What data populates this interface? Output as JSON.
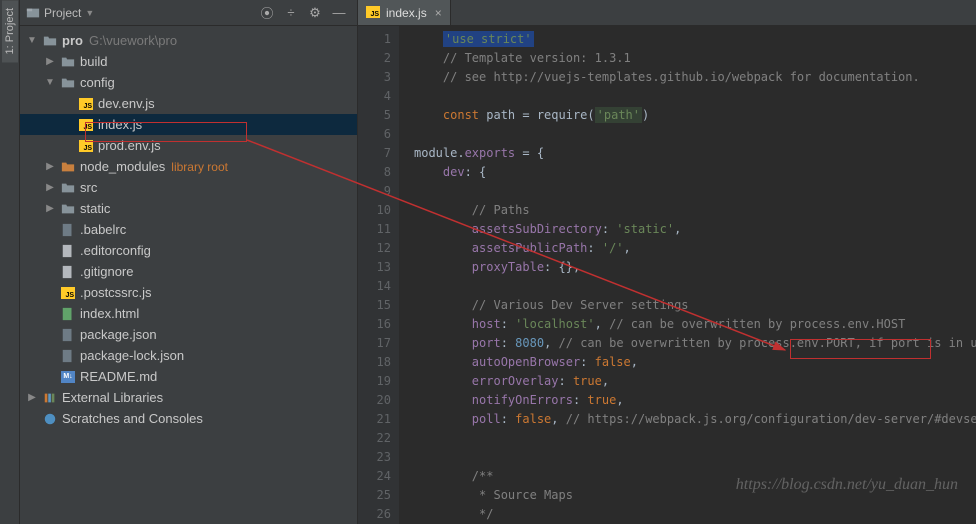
{
  "sidebar": {
    "tab_label": "1: Project"
  },
  "panel": {
    "title": "Project"
  },
  "project": {
    "root_name": "pro",
    "root_path": "G:\\vuework\\pro",
    "folders": {
      "build": "build",
      "config": "config",
      "dev_env": "dev.env.js",
      "index_js": "index.js",
      "prod_env": "prod.env.js",
      "node_modules": "node_modules",
      "library_root": "library root",
      "src": "src",
      "static": "static",
      "babelrc": ".babelrc",
      "editorconfig": ".editorconfig",
      "gitignore": ".gitignore",
      "postcssrc": ".postcssrc.js",
      "index_html": "index.html",
      "package_json": "package.json",
      "package_lock": "package-lock.json",
      "readme": "README.md"
    },
    "external_libs": "External Libraries",
    "scratches": "Scratches and Consoles"
  },
  "tabs": [
    {
      "label": "index.js"
    }
  ],
  "code": {
    "lines": [
      {
        "n": 1,
        "segs": [
          {
            "t": "    ",
            "c": ""
          },
          {
            "t": "'use strict'",
            "c": "tok-str hl-box"
          }
        ]
      },
      {
        "n": 2,
        "segs": [
          {
            "t": "    ",
            "c": ""
          },
          {
            "t": "//",
            "c": "tok-com"
          },
          {
            "t": " Template version: 1.3.1",
            "c": "tok-com"
          }
        ]
      },
      {
        "n": 3,
        "segs": [
          {
            "t": "    ",
            "c": ""
          },
          {
            "t": "// see http://vuejs-templates.github.io/webpack for documentation.",
            "c": "tok-com"
          }
        ]
      },
      {
        "n": 4,
        "segs": []
      },
      {
        "n": 5,
        "segs": [
          {
            "t": "    ",
            "c": ""
          },
          {
            "t": "const",
            "c": "tok-kw"
          },
          {
            "t": " path = ",
            "c": ""
          },
          {
            "t": "require",
            "c": ""
          },
          {
            "t": "(",
            "c": ""
          },
          {
            "t": "'path'",
            "c": "tok-str hl-green"
          },
          {
            "t": ")",
            "c": ""
          }
        ]
      },
      {
        "n": 6,
        "segs": []
      },
      {
        "n": 7,
        "segs": [
          {
            "t": "module.",
            "c": ""
          },
          {
            "t": "exports",
            "c": "tok-prop"
          },
          {
            "t": " = {",
            "c": ""
          }
        ]
      },
      {
        "n": 8,
        "segs": [
          {
            "t": "    ",
            "c": ""
          },
          {
            "t": "dev",
            "c": "tok-prop"
          },
          {
            "t": ": {",
            "c": ""
          }
        ]
      },
      {
        "n": 9,
        "segs": []
      },
      {
        "n": 10,
        "segs": [
          {
            "t": "        ",
            "c": ""
          },
          {
            "t": "// Paths",
            "c": "tok-com"
          }
        ]
      },
      {
        "n": 11,
        "segs": [
          {
            "t": "        ",
            "c": ""
          },
          {
            "t": "assetsSubDirectory",
            "c": "tok-prop"
          },
          {
            "t": ": ",
            "c": ""
          },
          {
            "t": "'static'",
            "c": "tok-str"
          },
          {
            "t": ",",
            "c": ""
          }
        ]
      },
      {
        "n": 12,
        "segs": [
          {
            "t": "        ",
            "c": ""
          },
          {
            "t": "assetsPublicPath",
            "c": "tok-prop"
          },
          {
            "t": ": ",
            "c": ""
          },
          {
            "t": "'/'",
            "c": "tok-str"
          },
          {
            "t": ",",
            "c": ""
          }
        ]
      },
      {
        "n": 13,
        "segs": [
          {
            "t": "        ",
            "c": ""
          },
          {
            "t": "proxyTable",
            "c": "tok-prop"
          },
          {
            "t": ": {},",
            "c": ""
          }
        ]
      },
      {
        "n": 14,
        "segs": []
      },
      {
        "n": 15,
        "segs": [
          {
            "t": "        ",
            "c": ""
          },
          {
            "t": "// Various Dev Server settings",
            "c": "tok-com"
          }
        ]
      },
      {
        "n": 16,
        "segs": [
          {
            "t": "        ",
            "c": ""
          },
          {
            "t": "host",
            "c": "tok-prop"
          },
          {
            "t": ": ",
            "c": ""
          },
          {
            "t": "'localhost'",
            "c": "tok-str"
          },
          {
            "t": ", ",
            "c": ""
          },
          {
            "t": "// can be overwritten by process.env.HOST",
            "c": "tok-com"
          }
        ]
      },
      {
        "n": 17,
        "segs": [
          {
            "t": "        ",
            "c": ""
          },
          {
            "t": "port",
            "c": "tok-prop"
          },
          {
            "t": ": ",
            "c": ""
          },
          {
            "t": "8080",
            "c": "tok-num"
          },
          {
            "t": ", ",
            "c": ""
          },
          {
            "t": "// can be overwritten by process.env.PORT, if port is in use, a free one wil",
            "c": "tok-com"
          }
        ]
      },
      {
        "n": 18,
        "segs": [
          {
            "t": "        ",
            "c": ""
          },
          {
            "t": "autoOpenBrowser",
            "c": "tok-prop"
          },
          {
            "t": ": ",
            "c": ""
          },
          {
            "t": "false",
            "c": "tok-bool"
          },
          {
            "t": ",",
            "c": ""
          }
        ]
      },
      {
        "n": 19,
        "segs": [
          {
            "t": "        ",
            "c": ""
          },
          {
            "t": "errorOverlay",
            "c": "tok-prop"
          },
          {
            "t": ": ",
            "c": ""
          },
          {
            "t": "true",
            "c": "tok-bool"
          },
          {
            "t": ",",
            "c": ""
          }
        ]
      },
      {
        "n": 20,
        "segs": [
          {
            "t": "        ",
            "c": ""
          },
          {
            "t": "notifyOnErrors",
            "c": "tok-prop"
          },
          {
            "t": ": ",
            "c": ""
          },
          {
            "t": "true",
            "c": "tok-bool"
          },
          {
            "t": ",",
            "c": ""
          }
        ]
      },
      {
        "n": 21,
        "segs": [
          {
            "t": "        ",
            "c": ""
          },
          {
            "t": "poll",
            "c": "tok-prop"
          },
          {
            "t": ": ",
            "c": ""
          },
          {
            "t": "false",
            "c": "tok-bool"
          },
          {
            "t": ", ",
            "c": ""
          },
          {
            "t": "// https://webpack.js.org/configuration/dev-server/#devserver-watchoptions",
            "c": "tok-com"
          }
        ]
      },
      {
        "n": 22,
        "segs": []
      },
      {
        "n": 23,
        "segs": []
      },
      {
        "n": 24,
        "segs": [
          {
            "t": "        ",
            "c": ""
          },
          {
            "t": "/**",
            "c": "tok-com"
          }
        ]
      },
      {
        "n": 25,
        "segs": [
          {
            "t": "        ",
            "c": ""
          },
          {
            "t": " * Source Maps",
            "c": "tok-com"
          }
        ]
      },
      {
        "n": 26,
        "segs": [
          {
            "t": "        ",
            "c": ""
          },
          {
            "t": " */",
            "c": "tok-com"
          }
        ]
      }
    ]
  },
  "watermark": "https://blog.csdn.net/yu_duan_hun"
}
